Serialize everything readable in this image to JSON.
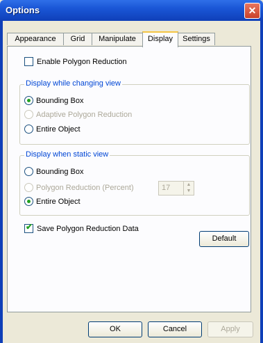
{
  "window": {
    "title": "Options",
    "close_glyph": "✕"
  },
  "tabs": [
    {
      "label": "Appearance",
      "active": false
    },
    {
      "label": "Grid",
      "active": false
    },
    {
      "label": "Manipulate",
      "active": false
    },
    {
      "label": "Display",
      "active": true
    },
    {
      "label": "Settings",
      "active": false
    }
  ],
  "enable_polygon_reduction": {
    "label": "Enable Polygon Reduction",
    "checked": false
  },
  "changing_view": {
    "legend": "Display while changing view",
    "options": [
      {
        "label": "Bounding Box",
        "selected": true,
        "disabled": false
      },
      {
        "label": "Adaptive Polygon Reduction",
        "selected": false,
        "disabled": true
      },
      {
        "label": "Entire Object",
        "selected": false,
        "disabled": false
      }
    ]
  },
  "static_view": {
    "legend": "Display when static view",
    "options": [
      {
        "label": "Bounding Box",
        "selected": false,
        "disabled": false
      },
      {
        "label": "Polygon Reduction (Percent)",
        "selected": false,
        "disabled": true
      },
      {
        "label": "Entire Object",
        "selected": true,
        "disabled": false
      }
    ],
    "percent_value": "17"
  },
  "save_polygon_reduction": {
    "label": "Save Polygon Reduction Data",
    "checked": true
  },
  "buttons": {
    "default": "Default",
    "ok": "OK",
    "cancel": "Cancel",
    "apply": "Apply"
  },
  "icons": {
    "checkmark": "✔",
    "spin_up": "▲",
    "spin_down": "▼"
  }
}
